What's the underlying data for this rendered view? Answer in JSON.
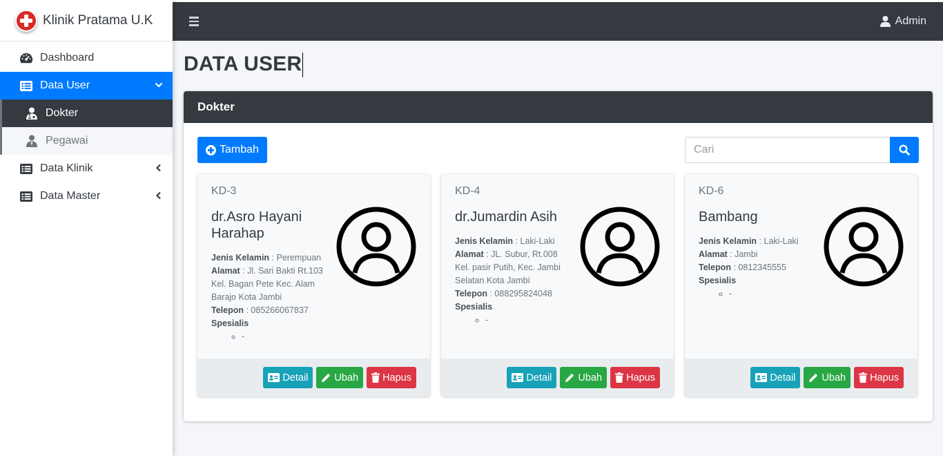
{
  "brand": {
    "name": "Klinik Pratama U.K"
  },
  "sidebar": {
    "items": [
      {
        "label": "Dashboard"
      },
      {
        "label": "Data User"
      },
      {
        "label": "Dokter"
      },
      {
        "label": "Pegawai"
      },
      {
        "label": "Data Klinik"
      },
      {
        "label": "Data Master"
      }
    ]
  },
  "topbar": {
    "user": "Admin"
  },
  "page": {
    "title": "DATA USER"
  },
  "panel": {
    "title": "Dokter",
    "add_label": "Tambah",
    "search_placeholder": "Cari"
  },
  "labels": {
    "jenis_kelamin": "Jenis Kelamin",
    "alamat": "Alamat",
    "telepon": "Telepon",
    "spesialis": "Spesialis",
    "detail": "Detail",
    "ubah": "Ubah",
    "hapus": "Hapus"
  },
  "doctors": [
    {
      "code": "KD-3",
      "name": "dr.Asro Hayani Harahap",
      "gender": "Perempuan",
      "address": "Jl. Sari Bakti Rt.103 Kel. Bagan Pete Kec. Alam Barajo Kota Jambi",
      "phone": "085266067837",
      "specialist": "-"
    },
    {
      "code": "KD-4",
      "name": "dr.Jumardin Asih",
      "gender": "Laki-Laki",
      "address": "JL. Subur, Rt.008 Kel. pasir Putih, Kec. Jambi Selatan Kota Jambi",
      "phone": "088295824048",
      "specialist": "-"
    },
    {
      "code": "KD-6",
      "name": "Bambang",
      "gender": "Laki-Laki",
      "address": "Jambi",
      "phone": "0812345555",
      "specialist": "-"
    }
  ],
  "colors": {
    "primary": "#007bff",
    "dark": "#343a40",
    "info": "#17a2b8",
    "success": "#28a745",
    "danger": "#dc3545"
  }
}
